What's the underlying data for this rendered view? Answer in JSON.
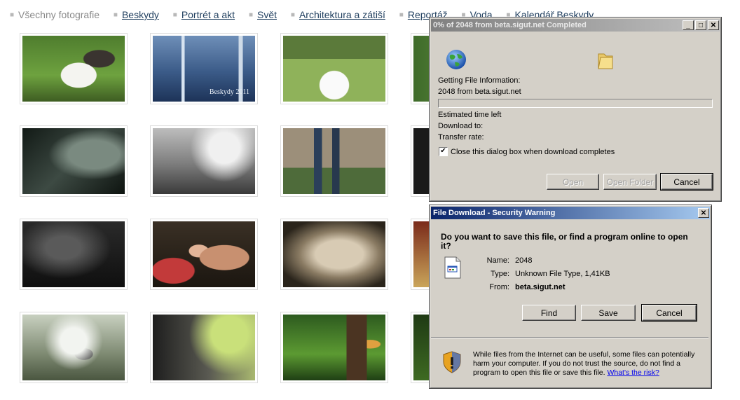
{
  "nav": {
    "items": [
      {
        "label": "Všechny fotografie",
        "current": true
      },
      {
        "label": "Beskydy",
        "current": false
      },
      {
        "label": "Portrét a akt",
        "current": false
      },
      {
        "label": "Svět",
        "current": false
      },
      {
        "label": "Architektura a zátiší",
        "current": false
      },
      {
        "label": "Reportáž",
        "current": false
      },
      {
        "label": "Voda",
        "current": false
      },
      {
        "label": "Kalendář Beskydy",
        "current": false
      }
    ]
  },
  "thumbnails": {
    "beskydy_caption": "Beskydy 2011"
  },
  "colors": {
    "link": "#1f3e5e",
    "active_title": "#0a246a",
    "dialog_face": "#d4d0c8"
  },
  "progress_dialog": {
    "title": "0% of 2048 from beta.sigut.net Completed",
    "status_label": "Getting File Information:",
    "status_detail": "2048 from beta.sigut.net",
    "progress_percent": 0,
    "estimated_label": "Estimated time left",
    "download_to_label": "Download to:",
    "transfer_rate_label": "Transfer rate:",
    "close_checkbox_label": "Close this dialog box when download completes",
    "close_checkbox_checked": true,
    "open_button": "Open",
    "open_folder_button": "Open Folder",
    "cancel_button": "Cancel",
    "icons": [
      "globe-icon",
      "folder-icon"
    ]
  },
  "security_dialog": {
    "title": "File Download - Security Warning",
    "question": "Do you want to save this file, or find a program online to open it?",
    "name_label": "Name:",
    "name_value": "2048",
    "type_label": "Type:",
    "type_value": "Unknown File Type, 1,41KB",
    "from_label": "From:",
    "from_value": "beta.sigut.net",
    "find_button": "Find",
    "save_button": "Save",
    "cancel_button": "Cancel",
    "warning_text": "While files from the Internet can be useful, some files can potentially harm your computer. If you do not trust the source, do not find a program to open this file or save this file.",
    "risk_link": "What's the risk?",
    "icons": [
      "file-icon",
      "shield-warning-icon"
    ]
  }
}
